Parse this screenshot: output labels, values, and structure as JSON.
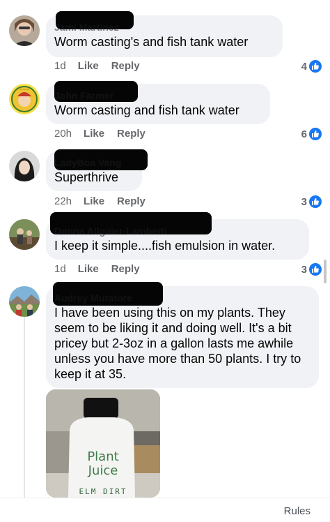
{
  "comments": [
    {
      "author": "Jami Martinez",
      "text": "Worm casting's and fish tank water",
      "time": "1d",
      "like": "Like",
      "reply": "Reply",
      "likes": "4"
    },
    {
      "author": "John Farmer",
      "text": "Worm casting and fish tank water",
      "time": "20h",
      "like": "Like",
      "reply": "Reply",
      "likes": "6"
    },
    {
      "author": "LadyBoa Vang",
      "text": "Superthrive",
      "time": "22h",
      "like": "Like",
      "reply": "Reply",
      "likes": "3"
    },
    {
      "author": "Donna Ailgaier-Lamberti",
      "text": "I keep it simple....fish emulsion in water.",
      "time": "1d",
      "like": "Like",
      "reply": "Reply",
      "likes": "3"
    },
    {
      "author": "Audrey Muratore",
      "text": "I have been using this on my plants. They seem to be liking it and doing well. It's a bit pricey but 2-3oz in a gallon lasts me awhile unless you have more than 50 plants. I try to keep it at 35."
    }
  ],
  "product": {
    "line1": "Plant",
    "line2": "Juice",
    "brand": "ELM DIRT"
  },
  "footer": {
    "rules": "Rules"
  },
  "colors": {
    "like_blue": "#1877f2",
    "bubble": "#f0f2f5",
    "meta": "#65676b"
  }
}
